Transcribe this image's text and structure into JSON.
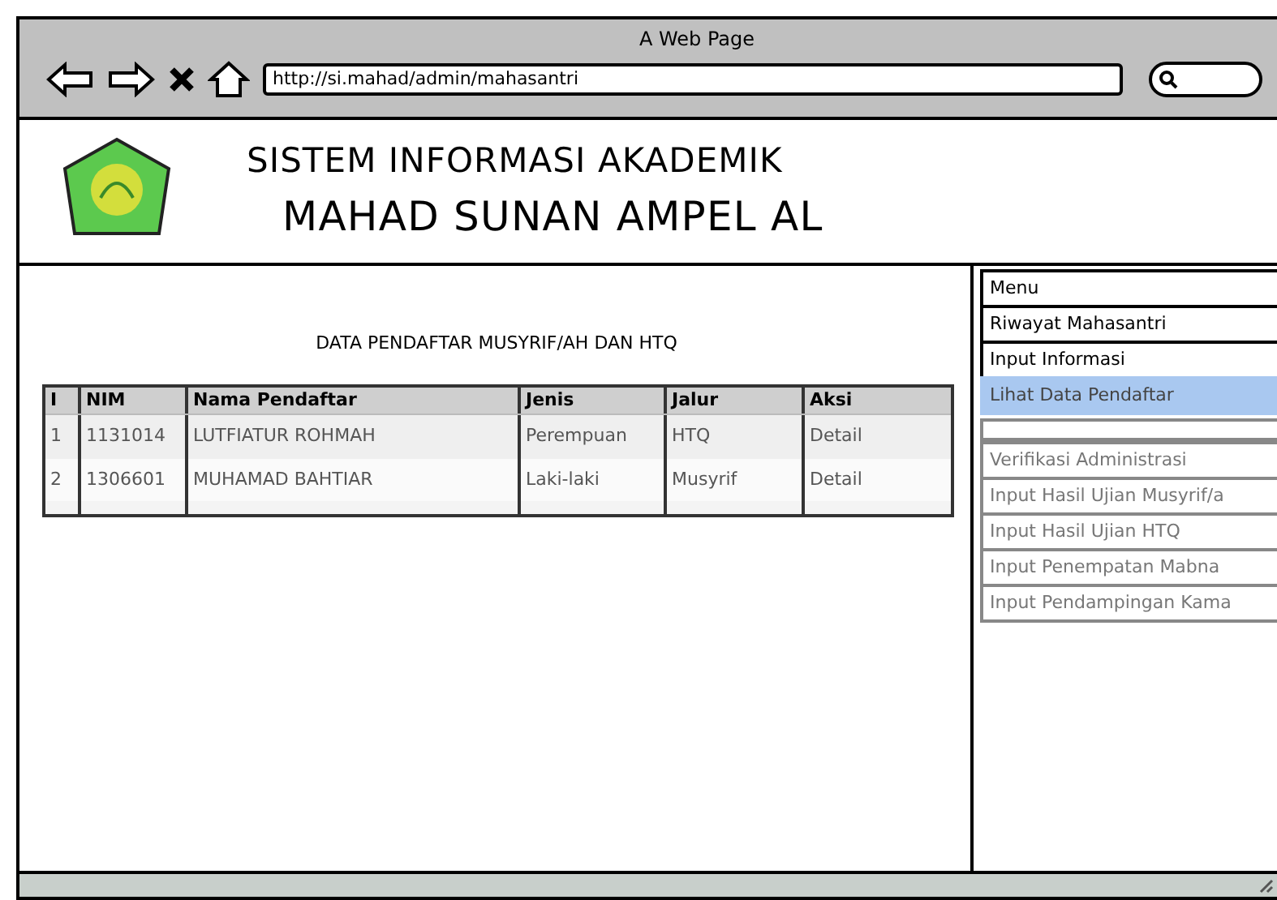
{
  "window": {
    "title": "A Web Page",
    "url": "http://si.mahad/admin/mahasantri"
  },
  "header": {
    "title_line_1": "SISTEM INFORMASI AKADEMIK",
    "title_line_2": "MAHAD SUNAN AMPEL AL"
  },
  "table": {
    "title": "DATA PENDAFTAR MUSYRIF/AH DAN HTQ",
    "columns": [
      "I",
      "NIM",
      "Nama Pendaftar",
      "Jenis",
      "Jalur",
      "Aksi"
    ],
    "rows": [
      [
        "1",
        "1131014",
        "LUTFIATUR ROHMAH",
        "Perempuan",
        "HTQ",
        "Detail"
      ],
      [
        "2",
        "1306601",
        "MUHAMAD BAHTIAR",
        "Laki-laki",
        "Musyrif",
        "Detail"
      ]
    ]
  },
  "menu": [
    {
      "kind": "item",
      "label": "Menu",
      "selected": false,
      "disabled": false
    },
    {
      "kind": "item",
      "label": "Riwayat Mahasantri",
      "selected": false,
      "disabled": false
    },
    {
      "kind": "item",
      "label": "Input Informasi",
      "selected": false,
      "disabled": false
    },
    {
      "kind": "item",
      "label": "Lihat Data Pendaftar",
      "selected": true,
      "disabled": false
    },
    {
      "kind": "separator"
    },
    {
      "kind": "item",
      "label": "Verifikasi Administrasi",
      "selected": false,
      "disabled": true
    },
    {
      "kind": "item",
      "label": "Input Hasil Ujian Musyrif/a",
      "selected": false,
      "disabled": true
    },
    {
      "kind": "item",
      "label": "Input Hasil Ujian HTQ",
      "selected": false,
      "disabled": true
    },
    {
      "kind": "item",
      "label": "Input Penempatan Mabna",
      "selected": false,
      "disabled": true
    },
    {
      "kind": "item",
      "label": "Input Pendampingan Kama",
      "selected": false,
      "disabled": true
    }
  ]
}
